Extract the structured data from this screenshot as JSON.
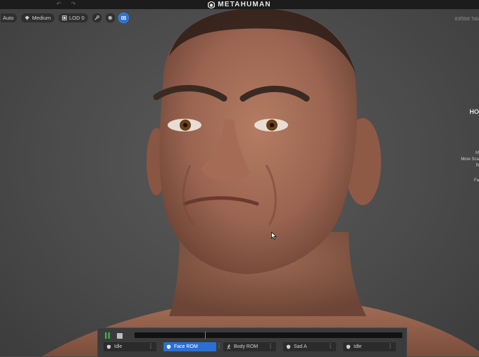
{
  "window": {
    "brand": "METAHUMAN"
  },
  "toolbar": {
    "quality_label": "Auto",
    "preset_label": "Medium",
    "lod_label": "LOD 0"
  },
  "viewport": {
    "info_text": "83f5b8 Tab"
  },
  "side_panel": {
    "heading": "HO",
    "lines": [
      "M",
      "More Sca",
      "R",
      "Fa"
    ]
  },
  "player": {
    "animations": [
      {
        "label": "Idle",
        "icon": "shield-icon",
        "active": false
      },
      {
        "label": "Face ROM",
        "icon": "shield-icon",
        "active": true
      },
      {
        "label": "Body ROM",
        "icon": "running-figure-icon",
        "active": false
      },
      {
        "label": "Sad A",
        "icon": "shield-icon",
        "active": false
      },
      {
        "label": "Idle",
        "icon": "shield-icon",
        "active": false
      }
    ]
  },
  "colors": {
    "accent": "#2a6fd6",
    "play": "#3fae3f"
  }
}
